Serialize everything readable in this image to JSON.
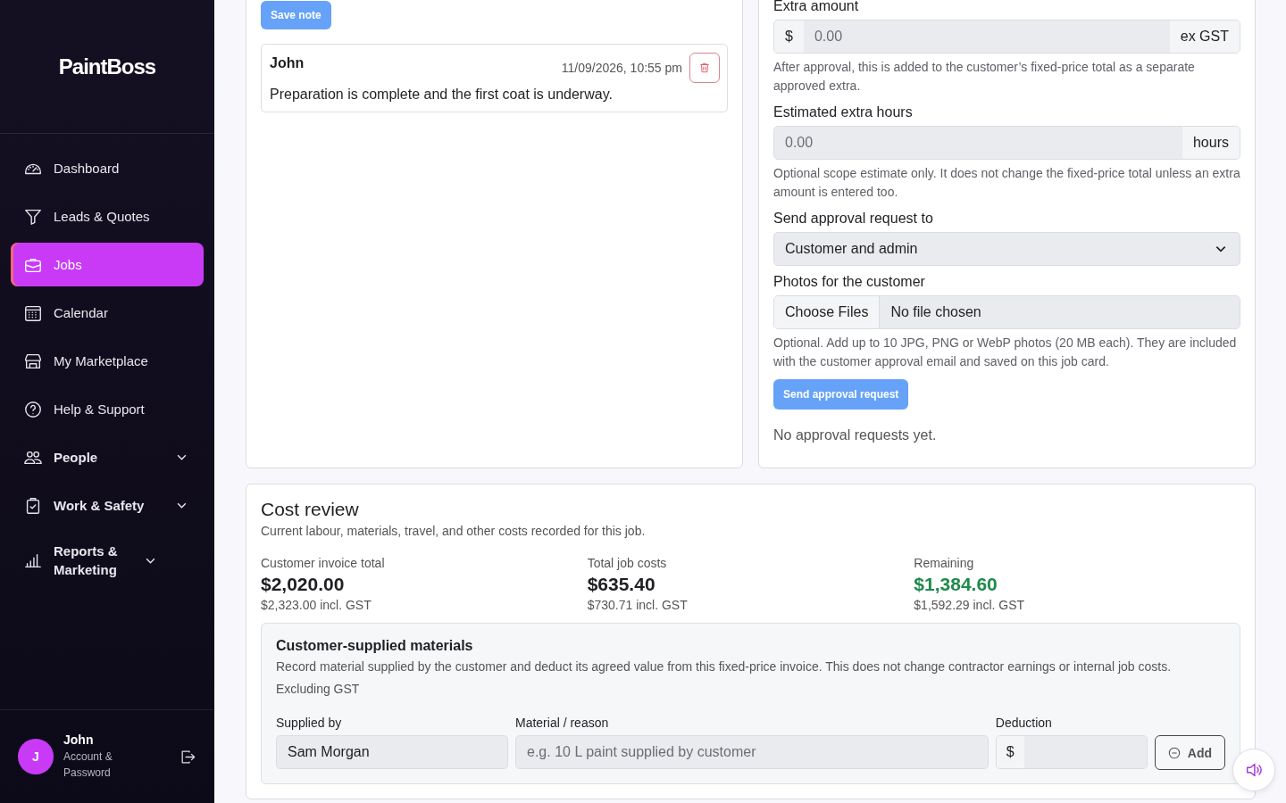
{
  "sidebar": {
    "logo": "PaintBoss",
    "items": [
      {
        "label": "Dashboard",
        "kind": "link",
        "selected": false
      },
      {
        "label": "Leads & Quotes",
        "kind": "link",
        "selected": false
      },
      {
        "label": "Jobs",
        "kind": "link",
        "selected": true
      },
      {
        "label": "Calendar",
        "kind": "link",
        "selected": false
      },
      {
        "label": "My Marketplace",
        "kind": "link",
        "selected": false
      },
      {
        "label": "Help & Support",
        "kind": "link",
        "selected": false
      },
      {
        "label": "People",
        "kind": "group",
        "selected": false,
        "expanded": false
      },
      {
        "label": "Work & Safety",
        "kind": "group",
        "selected": false,
        "expanded": false
      },
      {
        "label": "Reports & Marketing",
        "kind": "group",
        "selected": false,
        "expanded": false
      }
    ],
    "user": {
      "initial": "J",
      "name": "John",
      "subtitle": "Account & Password"
    }
  },
  "notes": {
    "save_button": {
      "label": "Save note",
      "disabled": true
    },
    "items": [
      {
        "author": "John",
        "time": "11/09/2026, 10:55 pm",
        "text": "Preparation is complete and the first coat is underway."
      }
    ]
  },
  "approval": {
    "extra_amount": {
      "label": "Extra amount",
      "prefix": "$",
      "placeholder": "0.00",
      "suffix": "ex GST",
      "help": "After approval, this is added to the customer’s fixed-price total as a separate approved extra."
    },
    "extra_hours": {
      "label": "Estimated extra hours",
      "placeholder": "0.00",
      "suffix": "hours",
      "help": "Optional scope estimate only. It does not change the fixed-price total unless an extra amount is entered too."
    },
    "recipient": {
      "label": "Send approval request to",
      "value": "Customer and admin"
    },
    "photos": {
      "label": "Photos for the customer",
      "button": "Choose Files",
      "status": "No file chosen",
      "help": "Optional. Add up to 10 JPG, PNG or WebP photos (20 MB each). They are included with the customer approval email and saved on this job card."
    },
    "send_button": {
      "label": "Send approval request",
      "disabled": true
    },
    "empty_text": "No approval requests yet."
  },
  "cost_review": {
    "title": "Cost review",
    "subtitle": "Current labour, materials, travel, and other costs recorded for this job.",
    "stats": [
      {
        "label": "Customer invoice total",
        "value": "$2,020.00",
        "sub": "$2,323.00 incl. GST",
        "color": "#1f1f24"
      },
      {
        "label": "Total job costs",
        "value": "$635.40",
        "sub": "$730.71 incl. GST",
        "color": "#1f1f24"
      },
      {
        "label": "Remaining",
        "value": "$1,384.60",
        "sub": "$1,592.29 incl. GST",
        "color": "#1f8a4c"
      }
    ],
    "materials": {
      "title": "Customer-supplied materials",
      "description": "Record material supplied by the customer and deduct its agreed value from this fixed-price invoice. This does not change contractor earnings or internal job costs.",
      "note": "Excluding GST",
      "supplied_by": {
        "label": "Supplied by",
        "value": "Sam Morgan"
      },
      "material": {
        "label": "Material / reason",
        "placeholder": "e.g. 10 L paint supplied by customer"
      },
      "deduction": {
        "label": "Deduction",
        "prefix": "$"
      },
      "add_button": {
        "label": "Add",
        "disabled": true
      }
    }
  }
}
